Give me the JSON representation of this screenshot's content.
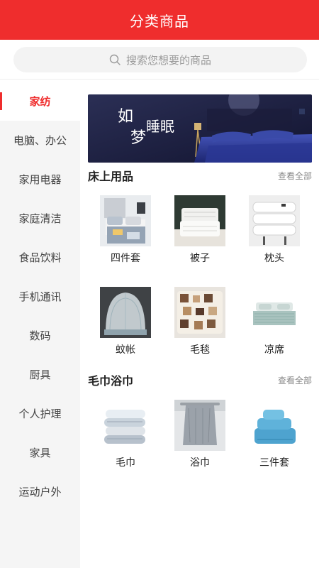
{
  "header": {
    "title": "分类商品"
  },
  "search": {
    "placeholder": "搜索您想要的商品"
  },
  "sidebar": {
    "items": [
      {
        "label": "家纺",
        "active": true
      },
      {
        "label": "电脑、办公",
        "active": false
      },
      {
        "label": "家用电器",
        "active": false
      },
      {
        "label": "家庭清洁",
        "active": false
      },
      {
        "label": "食品饮料",
        "active": false
      },
      {
        "label": "手机通讯",
        "active": false
      },
      {
        "label": "数码",
        "active": false
      },
      {
        "label": "厨具",
        "active": false
      },
      {
        "label": "个人护理",
        "active": false
      },
      {
        "label": "家具",
        "active": false
      },
      {
        "label": "运动户外",
        "active": false
      }
    ]
  },
  "banner": {
    "text_line1": "如",
    "text_line2": "梦",
    "text_line3": "睡眠"
  },
  "sections": [
    {
      "title": "床上用品",
      "view_all": "查看全部",
      "items": [
        {
          "label": "四件套",
          "icon": "bedding-set-icon"
        },
        {
          "label": "被子",
          "icon": "quilt-icon"
        },
        {
          "label": "枕头",
          "icon": "pillow-icon"
        },
        {
          "label": "蚊帐",
          "icon": "mosquito-net-icon"
        },
        {
          "label": "毛毯",
          "icon": "blanket-icon"
        },
        {
          "label": "凉席",
          "icon": "summer-mat-icon"
        }
      ]
    },
    {
      "title": "毛巾浴巾",
      "view_all": "查看全部",
      "items": [
        {
          "label": "毛巾",
          "icon": "towel-icon"
        },
        {
          "label": "浴巾",
          "icon": "bath-towel-icon"
        },
        {
          "label": "三件套",
          "icon": "towel-set-icon"
        }
      ]
    }
  ],
  "colors": {
    "accent": "#ef2d2d",
    "sidebar_bg": "#f5f5f5",
    "search_bg": "#f3f3f3"
  }
}
